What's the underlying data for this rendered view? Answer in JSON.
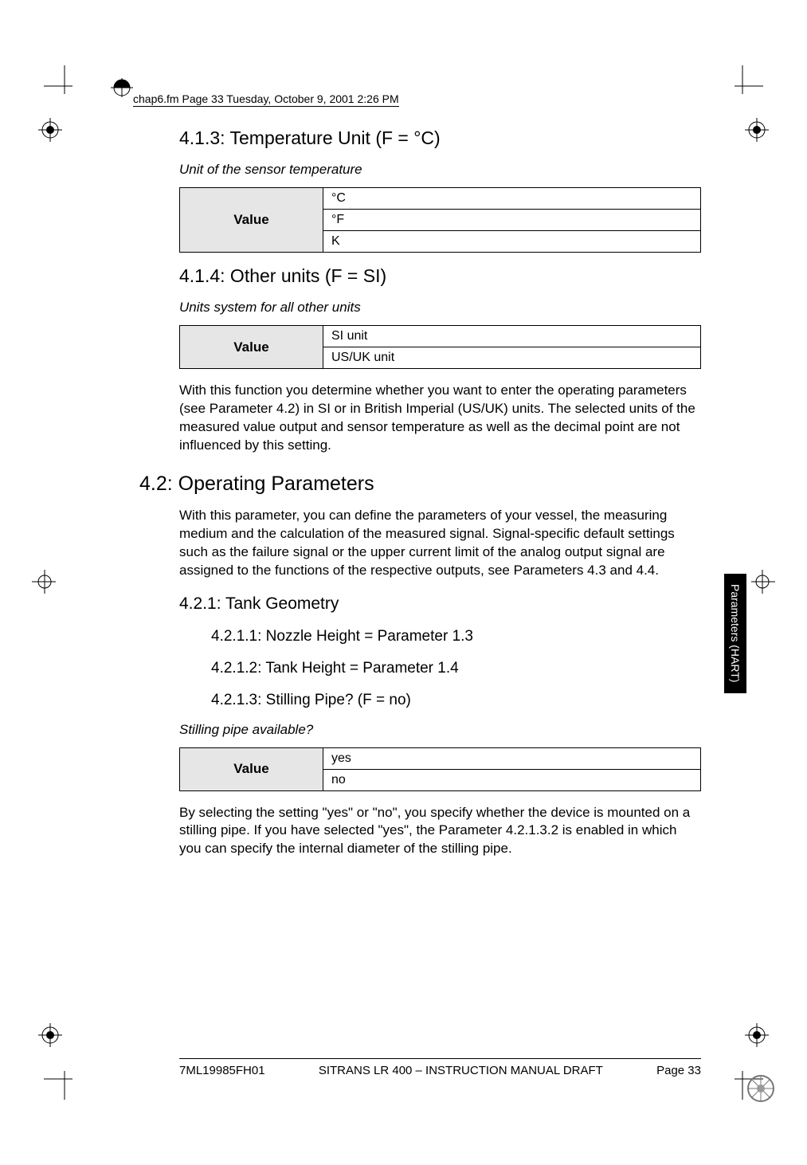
{
  "header": {
    "running_head": "chap6.fm  Page 33  Tuesday, October 9, 2001  2:26 PM"
  },
  "section_413": {
    "heading": "4.1.3: Temperature Unit (F = °C)",
    "caption": "Unit of the sensor temperature",
    "label": "Value",
    "rows": [
      "°C",
      "°F",
      "K"
    ]
  },
  "section_414": {
    "heading": "4.1.4: Other units (F = SI)",
    "caption": "Units system for all other units",
    "label": "Value",
    "rows": [
      "SI unit",
      "US/UK unit"
    ],
    "body": "With this function you determine whether you want to enter the operating parameters (see Parameter 4.2) in SI or in British Imperial (US/UK) units. The selected units of the measured value output and sensor temperature as well as the decimal point are not influenced by this setting."
  },
  "section_42": {
    "heading": "4.2: Operating Parameters",
    "body": "With this parameter, you can define the parameters of your vessel, the measuring medium and the calculation of the measured signal. Signal-specific default settings such as the failure signal or the upper current limit of the analog output signal are assigned to the functions of the respective outputs, see Parameters 4.3 and 4.4."
  },
  "section_421": {
    "heading": "4.2.1: Tank Geometry",
    "sub1": "4.2.1.1: Nozzle Height = Parameter 1.3",
    "sub2": "4.2.1.2: Tank Height = Parameter 1.4",
    "sub3": "4.2.1.3: Stilling Pipe? (F = no)",
    "caption": "Stilling pipe available?",
    "label": "Value",
    "rows": [
      "yes",
      "no"
    ],
    "body": "By selecting the setting \"yes\" or \"no\", you specify whether the device is mounted on a stilling pipe. If you have selected \"yes\", the Parameter 4.2.1.3.2 is enabled in which you can specify the internal diameter of the stilling pipe."
  },
  "side_tab": "Parameters (HART)",
  "footer": {
    "left": "7ML19985FH01",
    "center": "SITRANS LR 400 – INSTRUCTION MANUAL DRAFT",
    "right": "Page 33"
  }
}
